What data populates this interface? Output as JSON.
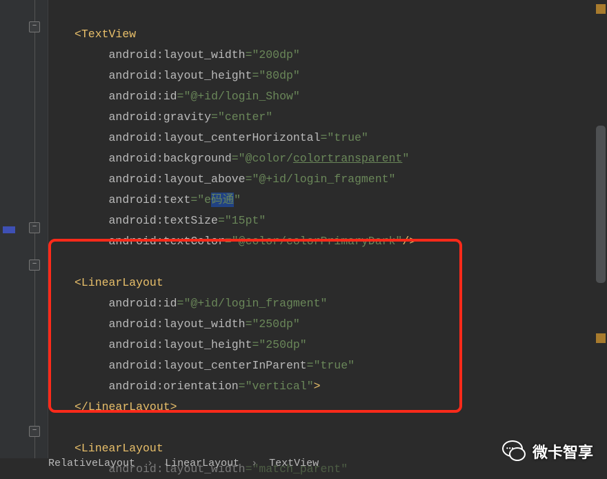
{
  "breadcrumb": {
    "a": "RelativeLayout",
    "b": "LinearLayout",
    "c": "TextView",
    "sep": "›"
  },
  "brand": {
    "label": "微卡智享"
  },
  "code": {
    "tag_textview": "TextView",
    "tag_linearlayout": "LinearLayout",
    "ns": "android",
    "sym_lt": "<",
    "sym_gt": ">",
    "sym_ltslash": "</",
    "sym_slashgt": "/>",
    "sym_colon": ":",
    "sym_eq": "=",
    "q": "\"",
    "attr": {
      "layout_width": "layout_width",
      "layout_height": "layout_height",
      "id": "id",
      "gravity": "gravity",
      "layout_centerHorizontal": "layout_centerHorizontal",
      "background": "background",
      "layout_above": "layout_above",
      "text": "text",
      "textSize": "textSize",
      "textColor": "textColor",
      "layout_centerInParent": "layout_centerInParent",
      "orientation": "orientation"
    },
    "val": {
      "w200": "200dp",
      "h80": "80dp",
      "id_show": "@+id/login_Show",
      "center": "center",
      "true": "true",
      "bg_color": "@color/",
      "bg_color_name": "colortransparent",
      "above": "@+id/login_fragment",
      "text_prefix": "e",
      "text_sel": "码通",
      "tsize": "15pt",
      "tcolor": "@color/colorPrimaryDark",
      "id_frag": "@+id/login_fragment",
      "w250": "250dp",
      "h250": "250dp",
      "vertical": "vertical",
      "match_parent": "match_parent"
    }
  }
}
